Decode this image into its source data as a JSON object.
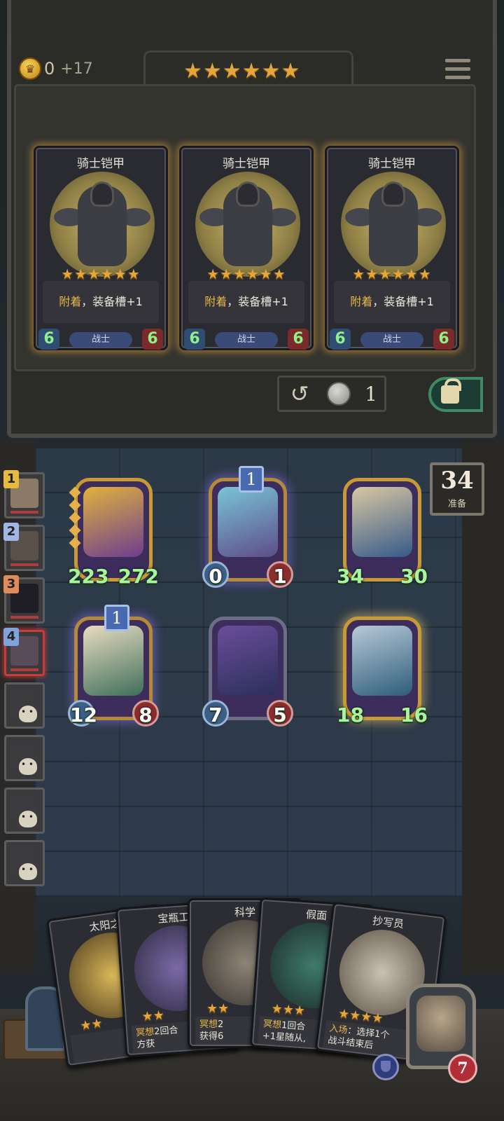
{
  "header": {
    "gold": "0",
    "gold_income": "+17",
    "tier_stars": "★★★★★★"
  },
  "shop_cards": [
    {
      "title": "骑士铠甲",
      "stars": "★★★★★★",
      "desc_keyword": "附着",
      "desc_rest": "，装备槽+1",
      "tribe": "战士",
      "attack": "6",
      "health": "6"
    },
    {
      "title": "骑士铠甲",
      "stars": "★★★★★★",
      "desc_keyword": "附着",
      "desc_rest": "，装备槽+1",
      "tribe": "战士",
      "attack": "6",
      "health": "6"
    },
    {
      "title": "骑士铠甲",
      "stars": "★★★★★★",
      "desc_keyword": "附着",
      "desc_rest": "，装备槽+1",
      "tribe": "战士",
      "attack": "6",
      "health": "6"
    }
  ],
  "refresh": {
    "cost": "1"
  },
  "turn": {
    "number": "34",
    "label": "准备"
  },
  "board_units": [
    {
      "attack": "223",
      "health": "272",
      "level": "",
      "style": "gold"
    },
    {
      "attack": "0",
      "health": "1",
      "level": "1",
      "style": "purple"
    },
    {
      "attack": "34",
      "health": "30",
      "level": "",
      "style": "gold"
    },
    {
      "attack": "12",
      "health": "8",
      "level": "1",
      "style": "purple"
    },
    {
      "attack": "7",
      "health": "5",
      "level": "",
      "style": "blue"
    },
    {
      "attack": "18",
      "health": "16",
      "level": "",
      "style": "glow"
    }
  ],
  "players": [
    {
      "rank": "1",
      "rank_color": "#e8b93f",
      "alive": true
    },
    {
      "rank": "2",
      "rank_color": "#9fb7e2",
      "alive": true
    },
    {
      "rank": "3",
      "rank_color": "#e08b5a",
      "alive": true
    },
    {
      "rank": "4",
      "rank_color": "#7ea4dc",
      "alive": true,
      "me": true
    },
    {
      "rank": "",
      "alive": false
    },
    {
      "rank": "",
      "alive": false
    },
    {
      "rank": "",
      "alive": false
    },
    {
      "rank": "",
      "alive": false
    }
  ],
  "hand_cards": [
    {
      "title": "太阳之",
      "stars": "★★",
      "desc_keyword": "",
      "desc_rest": ""
    },
    {
      "title": "宝瓶工",
      "stars": "★★",
      "desc_keyword": "冥想",
      "desc_rest": "2回合\n方获"
    },
    {
      "title": "科学",
      "stars": "★★",
      "desc_keyword": "冥想",
      "desc_rest": "2\n获得6"
    },
    {
      "title": "假面",
      "stars": "★★★",
      "desc_keyword": "冥想",
      "desc_rest": "1回合\n+1星随从,"
    },
    {
      "title": "抄写员",
      "stars": "★★★★",
      "desc_keyword": "入场",
      "desc_rest": "：选择1个\n战斗结束后"
    }
  ],
  "hero": {
    "health": "7"
  },
  "colors": {
    "accent_gold": "#e2a63a",
    "attack_green": "#8ef089",
    "lock_green": "#3f8a64"
  }
}
